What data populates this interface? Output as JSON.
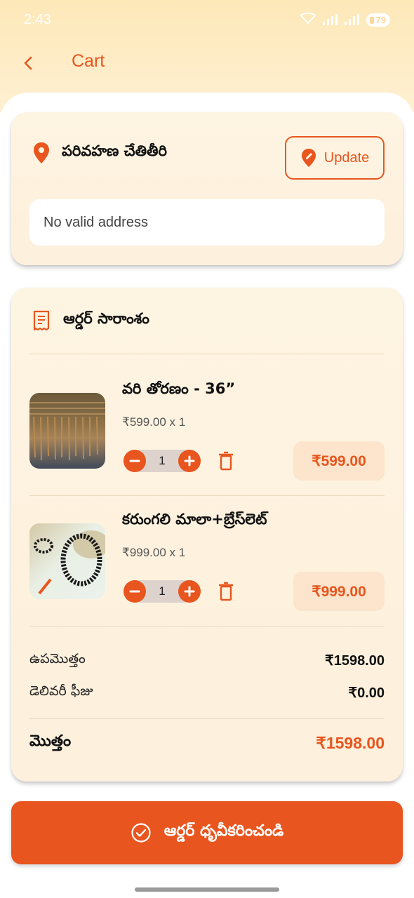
{
  "status_bar": {
    "time": "2:43",
    "battery": "79"
  },
  "header": {
    "title": "Cart",
    "back_icon": "chevron-left-icon"
  },
  "address": {
    "title": "పరివహణ చేతితీరి",
    "update_label": "Update",
    "value": "No valid address"
  },
  "summary": {
    "title": "ఆర్డర్ సారాంశం",
    "items": [
      {
        "name": "వరి తోరణం - 36”",
        "price_qty": "₹599.00 x 1",
        "quantity": "1",
        "line_total": "₹599.00"
      },
      {
        "name": "కరుంగలి మాలా+బ్రేస్‌లెట్",
        "price_qty": "₹999.00 x 1",
        "quantity": "1",
        "line_total": "₹999.00"
      }
    ],
    "subtotal_label": "ఉపమొత్తం",
    "subtotal_value": "₹1598.00",
    "delivery_label": "డెలివరీ ఫీజు",
    "delivery_value": "₹0.00",
    "total_label": "మొత్తం",
    "total_value": "₹1598.00"
  },
  "confirm_label": "ఆర్డర్ ధృవీకరించండి",
  "colors": {
    "accent": "#e8551e",
    "card_bg": "#fef4e2",
    "header_bg": "#fde8b8"
  }
}
